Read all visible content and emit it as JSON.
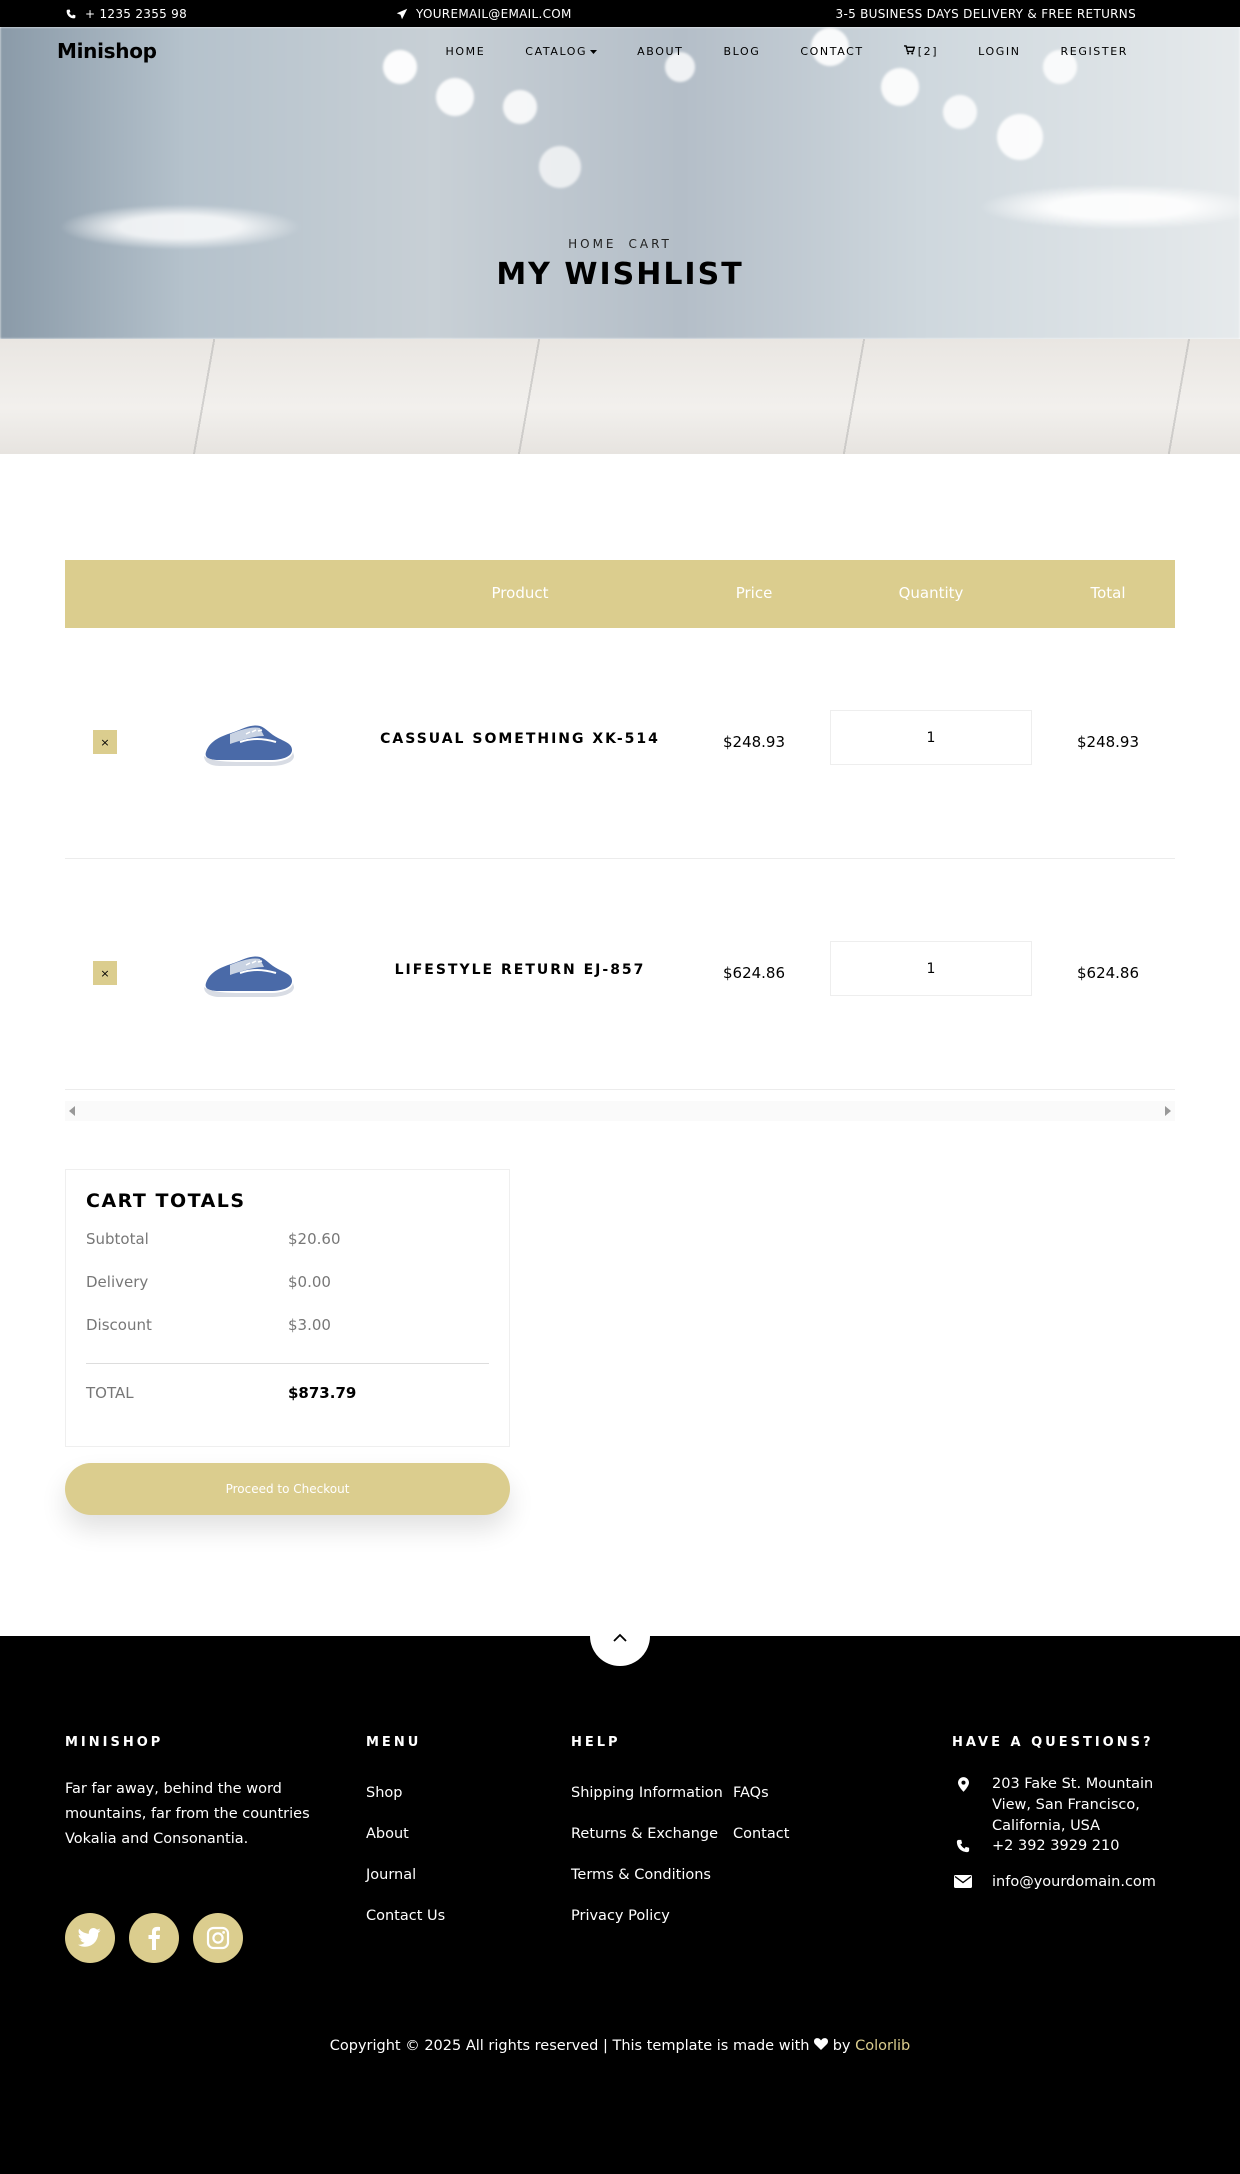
{
  "topbar": {
    "phone": "+ 1235 2355 98",
    "email": "YOUREMAIL@EMAIL.COM",
    "delivery": "3-5 BUSINESS DAYS DELIVERY & FREE RETURNS",
    "phone_icon": "phone-icon",
    "email_icon": "paper-plane-icon"
  },
  "navbar": {
    "brand": "Minishop",
    "items": [
      "HOME",
      "CATALOG",
      "ABOUT",
      "BLOG",
      "CONTACT",
      "[2]",
      "LOGIN",
      "REGISTER"
    ],
    "cart_icon": "cart-icon"
  },
  "hero": {
    "breadcrumb": [
      "HOME",
      "CART"
    ],
    "title": "MY WISHLIST"
  },
  "cart": {
    "headers": [
      "Product",
      "Price",
      "Quantity",
      "Total"
    ],
    "remove_label": "×",
    "rows": [
      {
        "name": "CASSUAL SOMETHING XK-514",
        "price": "$248.93",
        "quantity": "1",
        "total": "$248.93"
      },
      {
        "name": "LIFESTYLE RETURN EJ-857",
        "price": "$624.86",
        "quantity": "1",
        "total": "$624.86"
      }
    ]
  },
  "totals": {
    "title": "CART TOTALS",
    "subtotal_label": "Subtotal",
    "subtotal": "$20.60",
    "delivery_label": "Delivery",
    "delivery": "$0.00",
    "discount_label": "Discount",
    "discount": "$3.00",
    "total_label": "TOTAL",
    "total": "$873.79",
    "checkout_label": "Proceed to Checkout"
  },
  "footer": {
    "about_title": "MINISHOP",
    "about_text": "Far far away, behind the word mountains, far from the countries Vokalia and Consonantia.",
    "social": [
      "twitter-icon",
      "facebook-icon",
      "instagram-icon"
    ],
    "menu_title": "MENU",
    "menu": [
      "Shop",
      "About",
      "Journal",
      "Contact Us"
    ],
    "help_title": "HELP",
    "help_col1": [
      "Shipping Information",
      "Returns & Exchange",
      "Terms & Conditions",
      "Privacy Policy"
    ],
    "help_col2": [
      "FAQs",
      "Contact"
    ],
    "questions_title": "HAVE A QUESTIONS?",
    "address": "203 Fake St. Mountain View, San Francisco, California, USA",
    "phone": "+2 392 3929 210",
    "email": "info@yourdomain.com",
    "copyright_prefix": "Copyright © 2025 All rights reserved | This template is made with",
    "copyright_by": "by",
    "copyright_link": "Colorlib"
  },
  "colors": {
    "accent": "#dbcd8e",
    "dark": "#000000"
  }
}
